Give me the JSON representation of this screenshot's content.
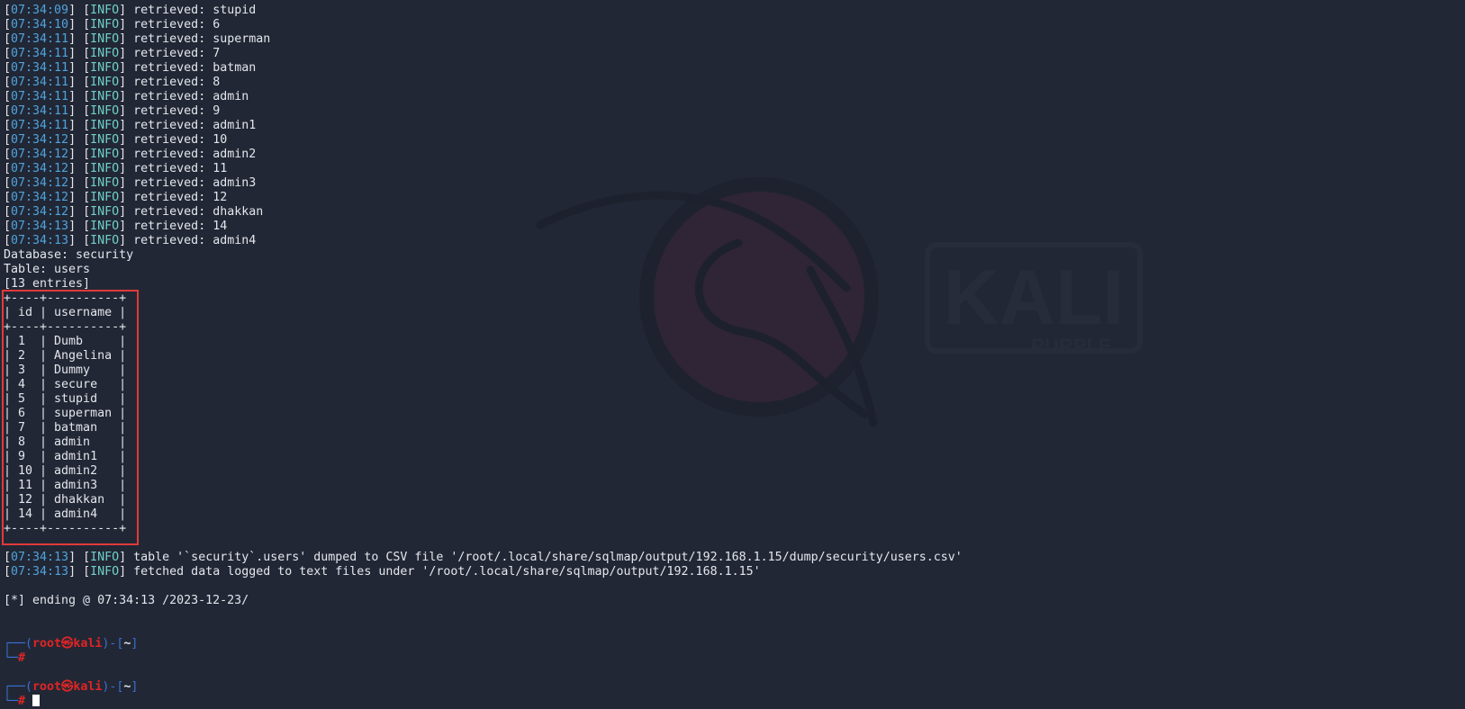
{
  "theme": {
    "background": "#222735",
    "timestamp_color": "#4ea4de",
    "info_color": "#6fd0c8",
    "prompt_user_color": "#e02525",
    "prompt_frame_color": "#3b6fd4",
    "highlight_color": "#e23a3a"
  },
  "wallpaper": {
    "logo_text": "KALI",
    "logo_subtext": "PURPLE"
  },
  "log_top": [
    {
      "ts": "07:34:09",
      "level": "INFO",
      "msg": "retrieved: stupid"
    },
    {
      "ts": "07:34:10",
      "level": "INFO",
      "msg": "retrieved: 6"
    },
    {
      "ts": "07:34:11",
      "level": "INFO",
      "msg": "retrieved: superman"
    },
    {
      "ts": "07:34:11",
      "level": "INFO",
      "msg": "retrieved: 7"
    },
    {
      "ts": "07:34:11",
      "level": "INFO",
      "msg": "retrieved: batman"
    },
    {
      "ts": "07:34:11",
      "level": "INFO",
      "msg": "retrieved: 8"
    },
    {
      "ts": "07:34:11",
      "level": "INFO",
      "msg": "retrieved: admin"
    },
    {
      "ts": "07:34:11",
      "level": "INFO",
      "msg": "retrieved: 9"
    },
    {
      "ts": "07:34:11",
      "level": "INFO",
      "msg": "retrieved: admin1"
    },
    {
      "ts": "07:34:12",
      "level": "INFO",
      "msg": "retrieved: 10"
    },
    {
      "ts": "07:34:12",
      "level": "INFO",
      "msg": "retrieved: admin2"
    },
    {
      "ts": "07:34:12",
      "level": "INFO",
      "msg": "retrieved: 11"
    },
    {
      "ts": "07:34:12",
      "level": "INFO",
      "msg": "retrieved: admin3"
    },
    {
      "ts": "07:34:12",
      "level": "INFO",
      "msg": "retrieved: 12"
    },
    {
      "ts": "07:34:12",
      "level": "INFO",
      "msg": "retrieved: dhakkan"
    },
    {
      "ts": "07:34:13",
      "level": "INFO",
      "msg": "retrieved: 14"
    },
    {
      "ts": "07:34:13",
      "level": "INFO",
      "msg": "retrieved: admin4"
    }
  ],
  "dump_header": {
    "database": "Database: security",
    "table": "Table: users",
    "entries": "[13 entries]"
  },
  "table": {
    "border_top": "+----+----------+",
    "header_row": "| id | username |",
    "border_mid": "+----+----------+",
    "rows": [
      "| 1  | Dumb     |",
      "| 2  | Angelina |",
      "| 3  | Dummy    |",
      "| 4  | secure   |",
      "| 5  | stupid   |",
      "| 6  | superman |",
      "| 7  | batman   |",
      "| 8  | admin    |",
      "| 9  | admin1   |",
      "| 10 | admin2   |",
      "| 11 | admin3   |",
      "| 12 | dhakkan  |",
      "| 14 | admin4   |"
    ],
    "border_bottom": "+----+----------+"
  },
  "log_bottom": [
    {
      "ts": "07:34:13",
      "level": "INFO",
      "msg": "table '`security`.users' dumped to CSV file '/root/.local/share/sqlmap/output/192.168.1.15/dump/security/users.csv'"
    },
    {
      "ts": "07:34:13",
      "level": "INFO",
      "msg": "fetched data logged to text files under '/root/.local/share/sqlmap/output/192.168.1.15'"
    }
  ],
  "ending_line": "[*] ending @ 07:34:13 /2023-12-23/",
  "prompts": [
    {
      "top_left": "┌──(",
      "user": "root㉿kali",
      "mid": ")-[",
      "dir": "~",
      "end": "]",
      "bottom_left": "└─",
      "hash": "#"
    },
    {
      "top_left": "┌──(",
      "user": "root㉿kali",
      "mid": ")-[",
      "dir": "~",
      "end": "]",
      "bottom_left": "└─",
      "hash": "#"
    }
  ]
}
